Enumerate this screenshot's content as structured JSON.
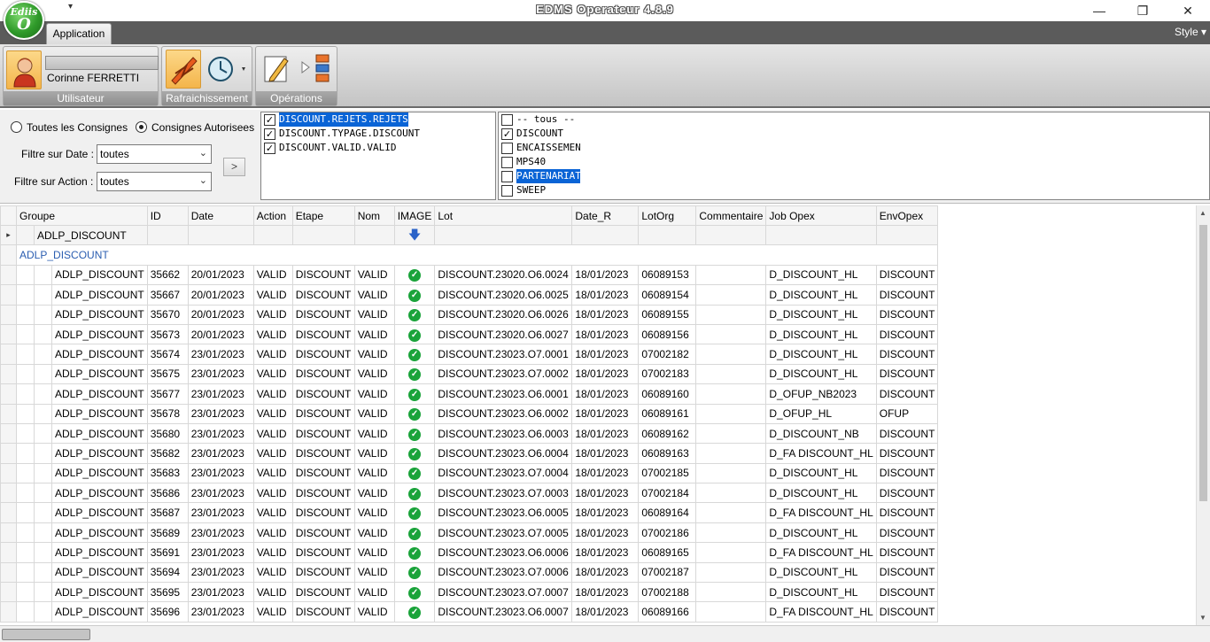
{
  "window": {
    "title": "EDMS Operateur 4.8.9",
    "logo_top": "Ediis",
    "logo_bottom": "O",
    "minimize": "—",
    "maximize": "❐",
    "close": "✕"
  },
  "ribbon": {
    "tab": "Application",
    "style_menu": "Style ▾",
    "groups": {
      "user": {
        "label": "Utilisateur",
        "user_name": "Corinne FERRETTI"
      },
      "refresh": {
        "label": "Rafraichissement"
      },
      "operations": {
        "label": "Opérations"
      }
    }
  },
  "filters": {
    "radio_all": "Toutes les Consignes",
    "radio_auth": "Consignes Autorisees",
    "radio_selected": "auth",
    "date_label": "Filtre sur Date :",
    "date_value": "toutes",
    "action_label": "Filtre sur Action :",
    "action_value": "toutes",
    "go": ">"
  },
  "type_list": [
    {
      "label": "DISCOUNT.REJETS.REJETS",
      "checked": true,
      "selected": true
    },
    {
      "label": "DISCOUNT.TYPAGE.DISCOUNT",
      "checked": true,
      "selected": false
    },
    {
      "label": "DISCOUNT.VALID.VALID",
      "checked": true,
      "selected": false
    }
  ],
  "ops_list": [
    {
      "label": "-- tous --",
      "checked": false,
      "selected": false
    },
    {
      "label": "DISCOUNT",
      "checked": true,
      "selected": false
    },
    {
      "label": "ENCAISSEMENT",
      "checked": false,
      "selected": false
    },
    {
      "label": "MPS40",
      "checked": false,
      "selected": false
    },
    {
      "label": "PARTENARIAT",
      "checked": false,
      "selected": true
    },
    {
      "label": "SWEEP",
      "checked": false,
      "selected": false
    }
  ],
  "grid": {
    "columns": [
      "Groupe",
      "ID",
      "Date",
      "Action",
      "Etape",
      "Nom",
      "IMAGE",
      "Lot",
      "Date_R",
      "LotOrg",
      "Commentaire",
      "Job Opex",
      "EnvOpex"
    ],
    "group_row": "ADLP_DISCOUNT",
    "subgroup_row": "ADLP_DISCOUNT",
    "rows": [
      [
        "ADLP_DISCOUNT",
        "35662",
        "20/01/2023",
        "VALID",
        "DISCOUNT",
        "VALID",
        "ok",
        "DISCOUNT.23020.O6.0024",
        "18/01/2023",
        "06089153",
        "",
        "D_DISCOUNT_HL",
        "DISCOUNT"
      ],
      [
        "ADLP_DISCOUNT",
        "35667",
        "20/01/2023",
        "VALID",
        "DISCOUNT",
        "VALID",
        "ok",
        "DISCOUNT.23020.O6.0025",
        "18/01/2023",
        "06089154",
        "",
        "D_DISCOUNT_HL",
        "DISCOUNT"
      ],
      [
        "ADLP_DISCOUNT",
        "35670",
        "20/01/2023",
        "VALID",
        "DISCOUNT",
        "VALID",
        "ok",
        "DISCOUNT.23020.O6.0026",
        "18/01/2023",
        "06089155",
        "",
        "D_DISCOUNT_HL",
        "DISCOUNT"
      ],
      [
        "ADLP_DISCOUNT",
        "35673",
        "20/01/2023",
        "VALID",
        "DISCOUNT",
        "VALID",
        "ok",
        "DISCOUNT.23020.O6.0027",
        "18/01/2023",
        "06089156",
        "",
        "D_DISCOUNT_HL",
        "DISCOUNT"
      ],
      [
        "ADLP_DISCOUNT",
        "35674",
        "23/01/2023",
        "VALID",
        "DISCOUNT",
        "VALID",
        "ok",
        "DISCOUNT.23023.O7.0001",
        "18/01/2023",
        "07002182",
        "",
        "D_DISCOUNT_HL",
        "DISCOUNT"
      ],
      [
        "ADLP_DISCOUNT",
        "35675",
        "23/01/2023",
        "VALID",
        "DISCOUNT",
        "VALID",
        "ok",
        "DISCOUNT.23023.O7.0002",
        "18/01/2023",
        "07002183",
        "",
        "D_DISCOUNT_HL",
        "DISCOUNT"
      ],
      [
        "ADLP_DISCOUNT",
        "35677",
        "23/01/2023",
        "VALID",
        "DISCOUNT",
        "VALID",
        "ok",
        "DISCOUNT.23023.O6.0001",
        "18/01/2023",
        "06089160",
        "",
        "D_OFUP_NB2023",
        "DISCOUNT"
      ],
      [
        "ADLP_DISCOUNT",
        "35678",
        "23/01/2023",
        "VALID",
        "DISCOUNT",
        "VALID",
        "ok",
        "DISCOUNT.23023.O6.0002",
        "18/01/2023",
        "06089161",
        "",
        "D_OFUP_HL",
        "OFUP"
      ],
      [
        "ADLP_DISCOUNT",
        "35680",
        "23/01/2023",
        "VALID",
        "DISCOUNT",
        "VALID",
        "ok",
        "DISCOUNT.23023.O6.0003",
        "18/01/2023",
        "06089162",
        "",
        "D_DISCOUNT_NB",
        "DISCOUNT"
      ],
      [
        "ADLP_DISCOUNT",
        "35682",
        "23/01/2023",
        "VALID",
        "DISCOUNT",
        "VALID",
        "ok",
        "DISCOUNT.23023.O6.0004",
        "18/01/2023",
        "06089163",
        "",
        "D_FA DISCOUNT_HL",
        "DISCOUNT"
      ],
      [
        "ADLP_DISCOUNT",
        "35683",
        "23/01/2023",
        "VALID",
        "DISCOUNT",
        "VALID",
        "ok",
        "DISCOUNT.23023.O7.0004",
        "18/01/2023",
        "07002185",
        "",
        "D_DISCOUNT_HL",
        "DISCOUNT"
      ],
      [
        "ADLP_DISCOUNT",
        "35686",
        "23/01/2023",
        "VALID",
        "DISCOUNT",
        "VALID",
        "ok",
        "DISCOUNT.23023.O7.0003",
        "18/01/2023",
        "07002184",
        "",
        "D_DISCOUNT_HL",
        "DISCOUNT"
      ],
      [
        "ADLP_DISCOUNT",
        "35687",
        "23/01/2023",
        "VALID",
        "DISCOUNT",
        "VALID",
        "ok",
        "DISCOUNT.23023.O6.0005",
        "18/01/2023",
        "06089164",
        "",
        "D_FA DISCOUNT_HL",
        "DISCOUNT"
      ],
      [
        "ADLP_DISCOUNT",
        "35689",
        "23/01/2023",
        "VALID",
        "DISCOUNT",
        "VALID",
        "ok",
        "DISCOUNT.23023.O7.0005",
        "18/01/2023",
        "07002186",
        "",
        "D_DISCOUNT_HL",
        "DISCOUNT"
      ],
      [
        "ADLP_DISCOUNT",
        "35691",
        "23/01/2023",
        "VALID",
        "DISCOUNT",
        "VALID",
        "ok",
        "DISCOUNT.23023.O6.0006",
        "18/01/2023",
        "06089165",
        "",
        "D_FA DISCOUNT_HL",
        "DISCOUNT"
      ],
      [
        "ADLP_DISCOUNT",
        "35694",
        "23/01/2023",
        "VALID",
        "DISCOUNT",
        "VALID",
        "ok",
        "DISCOUNT.23023.O7.0006",
        "18/01/2023",
        "07002187",
        "",
        "D_DISCOUNT_HL",
        "DISCOUNT"
      ],
      [
        "ADLP_DISCOUNT",
        "35695",
        "23/01/2023",
        "VALID",
        "DISCOUNT",
        "VALID",
        "ok",
        "DISCOUNT.23023.O7.0007",
        "18/01/2023",
        "07002188",
        "",
        "D_DISCOUNT_HL",
        "DISCOUNT"
      ],
      [
        "ADLP_DISCOUNT",
        "35696",
        "23/01/2023",
        "VALID",
        "DISCOUNT",
        "VALID",
        "ok",
        "DISCOUNT.23023.O6.0007",
        "18/01/2023",
        "06089166",
        "",
        "D_FA DISCOUNT_HL",
        "DISCOUNT"
      ]
    ],
    "status_icon": "check-circle-icon",
    "image_header_icon": "download-arrow-icon"
  },
  "colors": {
    "selection": "#0a64d6",
    "ok_icon": "#1aa33a",
    "ribbon_label": "#8e8e8e",
    "tab_strip": "#5b5b5b"
  }
}
